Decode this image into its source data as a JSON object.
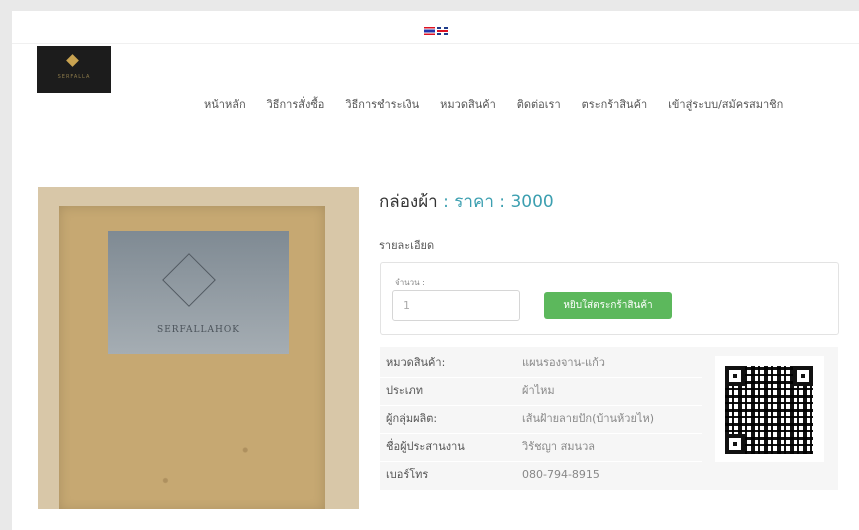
{
  "languages": [
    {
      "name": "thai-flag-icon"
    },
    {
      "name": "uk-flag-icon"
    }
  ],
  "logo": {
    "text": "SERFALLA",
    "icon": "knot-logo-icon"
  },
  "nav": {
    "items": [
      {
        "label": "หน้าหลัก"
      },
      {
        "label": "วิธีการสั่งซื้อ"
      },
      {
        "label": "วิธีการชำระเงิน"
      },
      {
        "label": "หมวดสินค้า"
      },
      {
        "label": "ติดต่อเรา"
      },
      {
        "label": "ตระกร้าสินค้า"
      },
      {
        "label": "เข้าสู่ระบบ/สมัครสมาชิก"
      }
    ]
  },
  "product": {
    "name": "กล่องผ้า",
    "separator": " : ",
    "price_label": "ราคา",
    "price_separator": " : ",
    "price": "3000",
    "detail_heading": "รายละเอียด",
    "photo_caption": "SERFALLAHOK"
  },
  "order": {
    "qty_label": "จำนวน :",
    "qty_value": "1",
    "add_to_cart_label": "หยิบใส่ตระกร้าสินค้า"
  },
  "info": {
    "rows": [
      {
        "label": "หมวดสินค้า:",
        "value": "แผนรองจาน-แก้ว"
      },
      {
        "label": "ประเภท",
        "value": "ผ้าไหม"
      },
      {
        "label": "ผู้กลุ่มผลิต:",
        "value": "เส้นฝ้ายลายปัก(บ้านห้วยไห)"
      },
      {
        "label": "ชื่อผู้ประสานงาน",
        "value": "วิรัชญา สมนวล"
      },
      {
        "label": "เบอร์โทร",
        "value": "080-794-8915"
      }
    ]
  },
  "colors": {
    "accent": "#3c9fb0",
    "button": "#5cb85c",
    "panel": "#f6f6f6"
  }
}
